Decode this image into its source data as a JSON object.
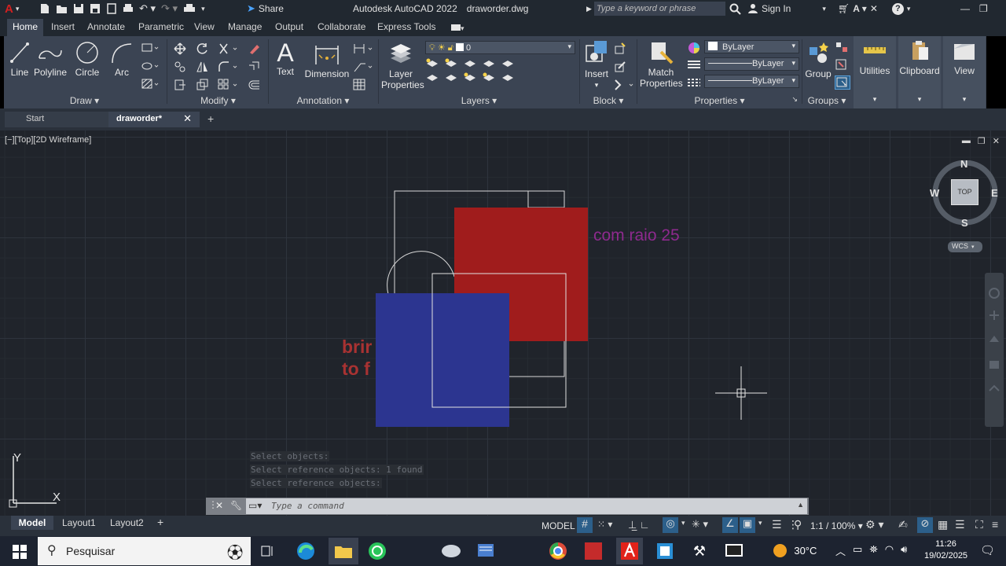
{
  "titlebar": {
    "app_title": "Autodesk AutoCAD 2022",
    "file_name": "draworder.dwg",
    "share_label": "Share",
    "search_placeholder": "Type a keyword or phrase",
    "sign_in_label": "Sign In"
  },
  "ribbon_tabs": [
    "Home",
    "Insert",
    "Annotate",
    "Parametric",
    "View",
    "Manage",
    "Output",
    "Collaborate",
    "Express Tools"
  ],
  "panels": {
    "draw": {
      "title": "Draw",
      "tools": [
        "Line",
        "Polyline",
        "Circle",
        "Arc"
      ]
    },
    "modify": {
      "title": "Modify"
    },
    "annotation": {
      "title": "Annotation",
      "tools": [
        "Text",
        "Dimension"
      ]
    },
    "layers": {
      "title": "Layers",
      "layer_properties": "Layer Properties",
      "current_layer": "0"
    },
    "block": {
      "title": "Block",
      "insert": "Insert"
    },
    "properties": {
      "title": "Properties",
      "match": "Match Properties",
      "color": "ByLayer",
      "linetype": "ByLayer",
      "lineweight": "ByLayer"
    },
    "groups": {
      "title": "Groups",
      "group": "Group"
    },
    "utilities": "Utilities",
    "clipboard": "Clipboard",
    "view": "View"
  },
  "file_tabs": {
    "start": "Start",
    "active": "draworder*"
  },
  "viewport": {
    "label": "[−][Top][2D Wireframe]",
    "text_purple": "com raio 25",
    "text_red_1": "brir",
    "text_red_2": "to f"
  },
  "viewcube": {
    "north": "N",
    "south": "S",
    "east": "E",
    "west": "W",
    "top": "TOP",
    "wcs": "WCS"
  },
  "ucs": {
    "y": "Y",
    "x": "X"
  },
  "command_history": [
    "Select objects:",
    "Select reference objects: 1 found",
    "Select reference objects:"
  ],
  "command_placeholder": "Type a command",
  "layout_tabs": [
    "Model",
    "Layout1",
    "Layout2"
  ],
  "status": {
    "model": "MODEL",
    "scale": "1:1 / 100%"
  },
  "taskbar": {
    "search_label": "Pesquisar",
    "temperature": "30°C",
    "time": "11:26",
    "date": "19/02/2025"
  },
  "colors": {
    "red_rect": "#a01c1c",
    "blue_rect": "#2c3590",
    "purple_text": "#8e2a8e",
    "red_text": "#a83232",
    "accent": "#1c6dd0"
  }
}
